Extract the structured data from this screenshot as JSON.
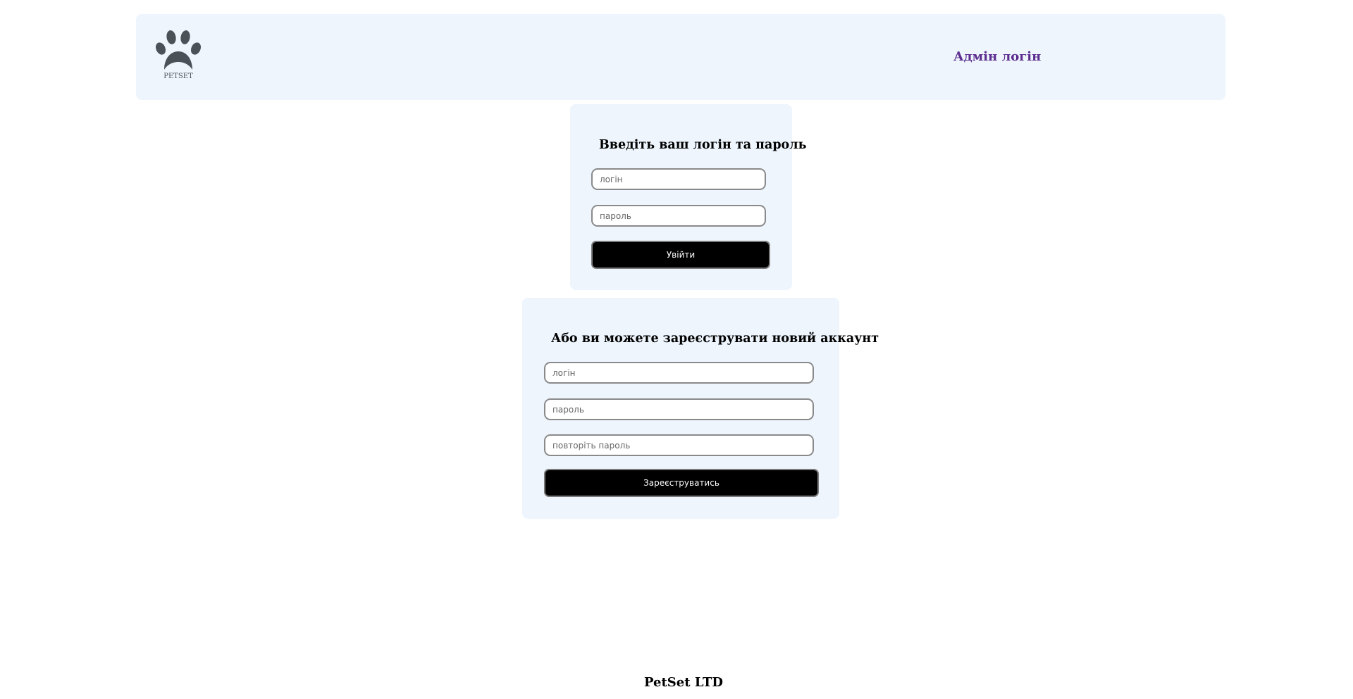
{
  "header": {
    "logo_text": "PETSET",
    "logo_icon": "paw-icon",
    "admin_link": "Адмін логін"
  },
  "login": {
    "title": "Введіть ваш логін та пароль",
    "login_placeholder": "логін",
    "password_placeholder": "пароль",
    "submit_label": "Увійти"
  },
  "register": {
    "title": "Або ви можете зареєструвати новий аккаунт",
    "login_placeholder": "логін",
    "password_placeholder": "пароль",
    "repeat_password_placeholder": "повторіть пароль",
    "submit_label": "Зареєструватись"
  },
  "footer": {
    "text": "PetSet LTD"
  },
  "colors": {
    "panel_bg": "#eef5fd",
    "admin_link": "#5b2d8e",
    "button_bg": "#000000",
    "logo": "#4a5157"
  }
}
